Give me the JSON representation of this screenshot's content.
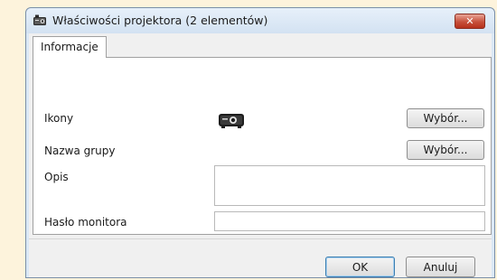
{
  "window": {
    "title": "Właściwości projektora (2 elementów)",
    "close_glyph": "✕"
  },
  "tabs": [
    {
      "label": "Informacje",
      "active": true
    }
  ],
  "form": {
    "icon_label": "Ikony",
    "icon_value": "projector-icon",
    "icon_button": "Wybór...",
    "group_label": "Nazwa grupy",
    "group_button": "Wybór...",
    "description_label": "Opis",
    "description_value": "",
    "monitor_password_label": "Hasło monitora",
    "monitor_password_value": ""
  },
  "footer": {
    "ok_label": "OK",
    "cancel_label": "Anuluj"
  },
  "colors": {
    "background": "#fdf3dc",
    "titlebar": "#dbe8f5",
    "close_button": "#c7503b"
  }
}
